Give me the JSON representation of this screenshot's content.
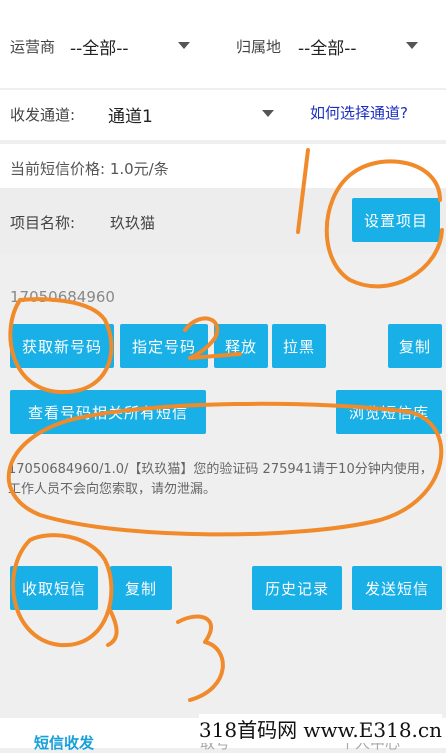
{
  "filters": {
    "operator_label": "运营商",
    "operator_value": "--全部--",
    "location_label": "归属地",
    "location_value": "--全部--"
  },
  "channel": {
    "label": "收发通道:",
    "value": "通道1",
    "help_link": "如何选择通道?"
  },
  "price_text": "当前短信价格: 1.0元/条",
  "project": {
    "label": "项目名称:",
    "name": "玖玖猫",
    "set_button": "设置项目"
  },
  "phone_number": "17050684960",
  "number_actions": {
    "get_new": "获取新号码",
    "assign": "指定号码",
    "release": "释放",
    "blacklist": "拉黑",
    "copy": "复制"
  },
  "sms_actions": {
    "view_all": "查看号码相关所有短信",
    "browse_lib": "浏览短信库"
  },
  "sms_content": "17050684960/1.0/【玖玖猫】您的验证码 275941请于10分钟内使用，工作人员不会向您索取，请勿泄漏。",
  "receive_actions": {
    "receive": "收取短信",
    "copy": "复制",
    "history": "历史记录",
    "send": "发送短信"
  },
  "bottom_tabs": {
    "sms": "短信收发",
    "other1": "取号",
    "other2": "个人中心"
  },
  "watermark": "318首码网 www.E318.cn",
  "annotations": [
    "1",
    "2",
    "3"
  ],
  "colors": {
    "button": "#18b0e6",
    "link": "#1c2fc0",
    "annotation": "#f08a2a"
  }
}
